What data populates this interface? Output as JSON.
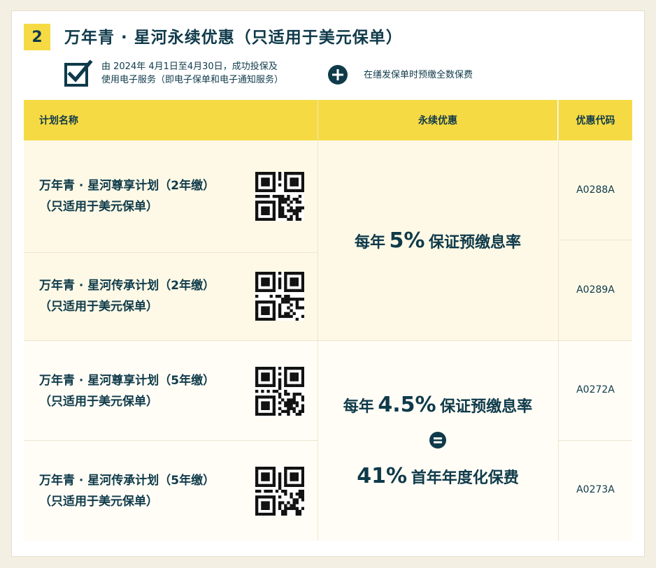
{
  "step": {
    "number": "2",
    "title": "万年青 · 星河永续优惠（只适用于美元保单）"
  },
  "conditions": {
    "first_line1": "由 2024年 4月1日至4月30日，成功投保及",
    "first_line2": "使用电子服务（即电子保单和电子通知服务）",
    "second": "在缮发保单时预缴全数保费"
  },
  "table": {
    "headers": {
      "plan": "计划名称",
      "offer": "永续优惠",
      "code": "优惠代码"
    },
    "rows": [
      {
        "name_line1": "万年青 · 星河尊享计划（2年缴）",
        "name_line2": "（只适用于美元保单）",
        "code": "A0288A"
      },
      {
        "name_line1": "万年青 · 星河传承计划（2年缴）",
        "name_line2": "（只适用于美元保单）",
        "code": "A0289A"
      },
      {
        "name_line1": "万年青 · 星河尊享计划（5年缴）",
        "name_line2": "（只适用于美元保单）",
        "code": "A0272A"
      },
      {
        "name_line1": "万年青 · 星河传承计划（5年缴）",
        "name_line2": "（只适用于美元保单）",
        "code": "A0273A"
      }
    ],
    "offers": {
      "group1": {
        "prefix": "每年",
        "value": "5%",
        "suffix": "保证预缴息率"
      },
      "group2": {
        "prefix": "每年",
        "value": "4.5%",
        "suffix": "保证预缴息率",
        "equals_icon": "equals-circle-icon",
        "second_value": "41%",
        "second_suffix": "首年年度化保费"
      }
    }
  },
  "icons": {
    "check": "checkbox-checked-icon",
    "plus": "plus-circle-icon",
    "qr": "qr-code-icon"
  },
  "colors": {
    "accent_yellow": "#f6da43",
    "text_dark": "#0f3a4a",
    "row_cream": "#fdf9e6"
  }
}
